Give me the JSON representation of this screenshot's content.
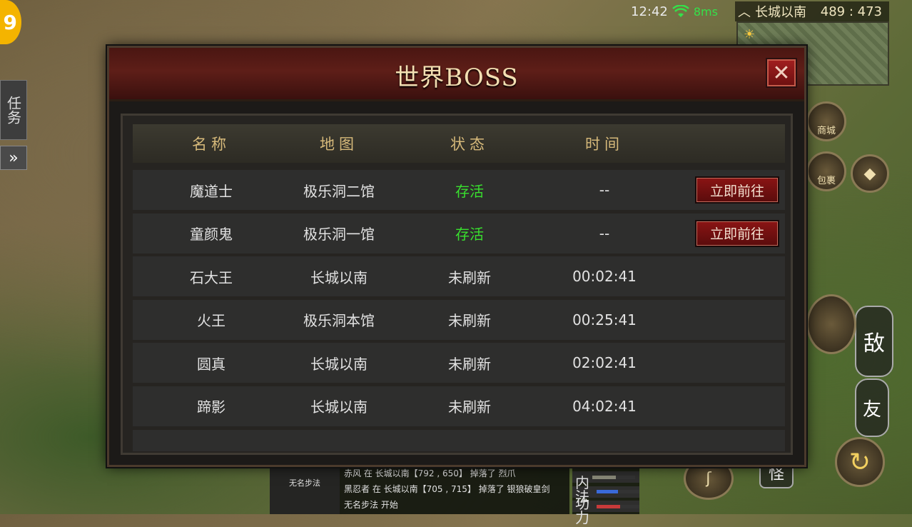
{
  "status_bar": {
    "time": "12:42",
    "latency": "8ms"
  },
  "location": {
    "name": "长城以南",
    "coords": "489 : 473"
  },
  "left_badge": "9",
  "task_tab": "任务",
  "side_buttons": {
    "shop": "商城",
    "bag": "包裹",
    "enemy": "敌",
    "friend": "友",
    "monster": "怪"
  },
  "chat": {
    "side_label": "无名步法",
    "lines": [
      "赤风 在 长城以南【792 , 650】 掉落了 烈爪",
      "黑忍者 在 长城以南【705 , 715】 掉落了 银狼破皇剑",
      "无名步法 开始"
    ]
  },
  "stats": {
    "labels": [
      "内功",
      "法力"
    ],
    "bars": [
      0.55,
      0.5,
      0.55
    ]
  },
  "modal": {
    "title": "世界BOSS",
    "columns": [
      "名称",
      "地图",
      "状态",
      "时间"
    ],
    "rows": [
      {
        "name": "魔道士",
        "map": "极乐洞二馆",
        "status": "存活",
        "time": "--",
        "action": "立即前往"
      },
      {
        "name": "童颜鬼",
        "map": "极乐洞一馆",
        "status": "存活",
        "time": "--",
        "action": "立即前往"
      },
      {
        "name": "石大王",
        "map": "长城以南",
        "status": "未刷新",
        "time": "00:02:41",
        "action": ""
      },
      {
        "name": "火王",
        "map": "极乐洞本馆",
        "status": "未刷新",
        "time": "00:25:41",
        "action": ""
      },
      {
        "name": "圆真",
        "map": "长城以南",
        "status": "未刷新",
        "time": "02:02:41",
        "action": ""
      },
      {
        "name": "蹄影",
        "map": "长城以南",
        "status": "未刷新",
        "time": "04:02:41",
        "action": ""
      }
    ]
  },
  "colors": {
    "alive": "#39e02e",
    "title": "#f3dfb2",
    "header_text": "#d6b97a"
  }
}
